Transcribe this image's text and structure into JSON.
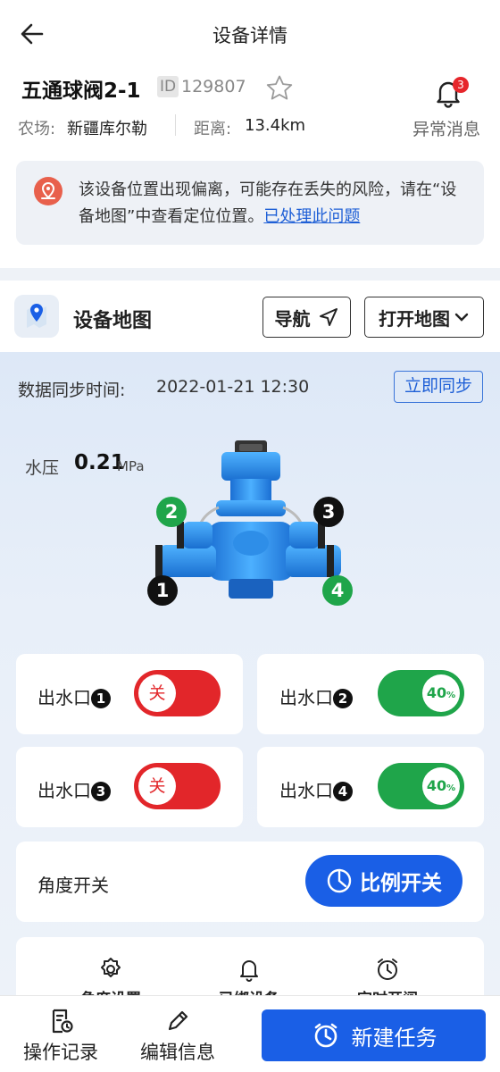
{
  "header": {
    "title": "设备详情",
    "back_icon": "arrow-left-icon"
  },
  "device": {
    "name": "五通球阀2-1",
    "id_label": "ID",
    "id_value": "129807",
    "farm_label": "农场:",
    "farm_value": "新疆库尔勒",
    "distance_label": "距离:",
    "distance_value": "13.4km",
    "alarm_count": "3",
    "alarm_label": "异常消息"
  },
  "warning": {
    "text": "该设备位置出现偏离，可能存在丢失的风险，请在“设备地图”中查看定位位置。",
    "link": "已处理此问题"
  },
  "map": {
    "title": "设备地图",
    "navigate_label": "导航",
    "open_map_label": "打开地图"
  },
  "sync": {
    "label": "数据同步时间:",
    "time": "2022-01-21  12:30",
    "button": "立即同步"
  },
  "pressure": {
    "label": "水压",
    "value": "0.21",
    "unit": "MPa"
  },
  "valve_markers": [
    "1",
    "2",
    "3",
    "4"
  ],
  "outlets": [
    {
      "label": "出水口",
      "num": "1",
      "state": "关",
      "on": false
    },
    {
      "label": "出水口",
      "num": "2",
      "state": "40",
      "unit": "%",
      "on": true
    },
    {
      "label": "出水口",
      "num": "3",
      "state": "关",
      "on": false
    },
    {
      "label": "出水口",
      "num": "4",
      "state": "40",
      "unit": "%",
      "on": true
    }
  ],
  "angle": {
    "label": "角度开关",
    "button": "比例开关"
  },
  "tools": [
    {
      "label": "角度设置",
      "icon": "gear-icon"
    },
    {
      "label": "已绑设备",
      "icon": "bell-icon"
    },
    {
      "label": "定时开阀",
      "icon": "alarm-clock-icon"
    }
  ],
  "bottom": {
    "log_label": "操作记录",
    "edit_label": "编辑信息",
    "new_task_label": "新建任务"
  },
  "colors": {
    "accent": "#1a5fe6",
    "on": "#1fa54a",
    "off": "#e2262a",
    "badge": "#e6262b"
  }
}
